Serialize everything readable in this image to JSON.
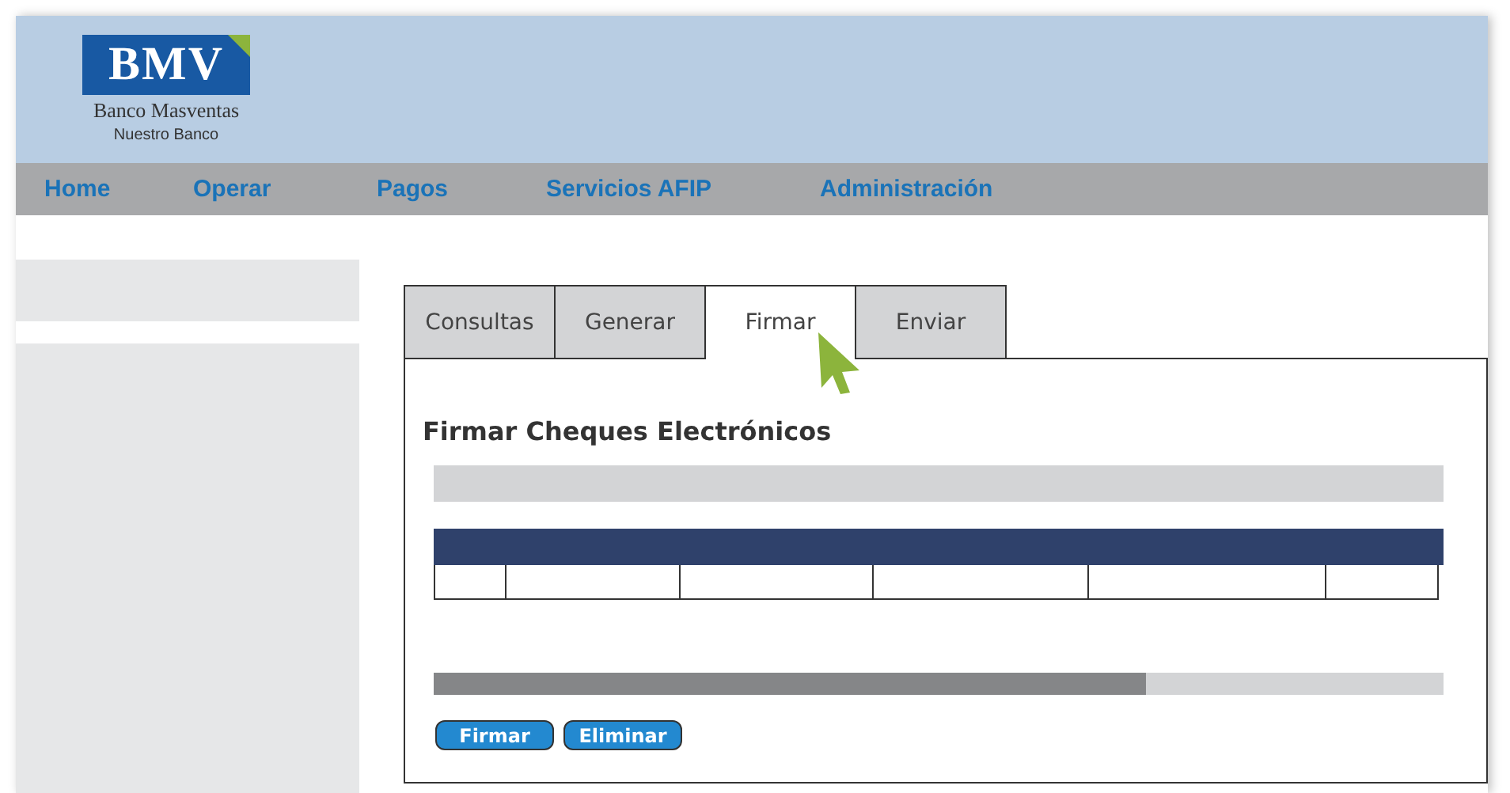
{
  "logo": {
    "mark": "BMV",
    "name": "Banco Masventas",
    "tagline": "Nuestro Banco"
  },
  "nav": [
    "Home",
    "Operar",
    "Pagos",
    "Servicios AFIP",
    "Administración"
  ],
  "tabs": [
    {
      "label": "Consultas",
      "selected": false
    },
    {
      "label": "Generar",
      "selected": false
    },
    {
      "label": "Firmar",
      "selected": true
    },
    {
      "label": "Enviar",
      "selected": false
    }
  ],
  "panel": {
    "title": "Firmar Cheques Electrónicos"
  },
  "buttons": [
    "Firmar",
    "Eliminar"
  ]
}
